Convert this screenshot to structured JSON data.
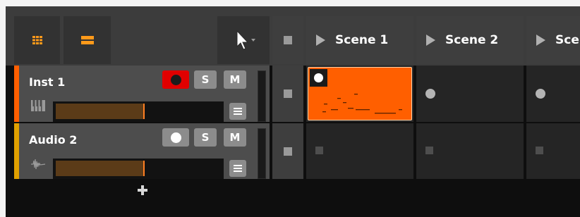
{
  "colors": {
    "accent": "#ff5f00",
    "accent_yellow": "#e8b400",
    "inst_track_color": "#ff5f00",
    "audio_track_color": "#e0a000",
    "record_armed": "#e00000"
  },
  "toolbar": {
    "grid_view_icon": "grid-icon",
    "mixer_view_icon": "mixer-icon",
    "pointer_tool_icon": "pointer-arrow-icon"
  },
  "scenes": [
    {
      "label": "Scene 1"
    },
    {
      "label": "Scene 2"
    },
    {
      "label": "Sce"
    }
  ],
  "tracks": [
    {
      "name": "Inst 1",
      "type_icon": "piano-keys-icon",
      "record_armed": true,
      "solo_label": "S",
      "mute_label": "M",
      "volume_level": 0.53
    },
    {
      "name": "Audio 2",
      "type_icon": "audio-waveform-icon",
      "record_armed": false,
      "solo_label": "S",
      "mute_label": "M",
      "volume_level": 0.53
    }
  ],
  "add_track_icon": "plus-icon"
}
